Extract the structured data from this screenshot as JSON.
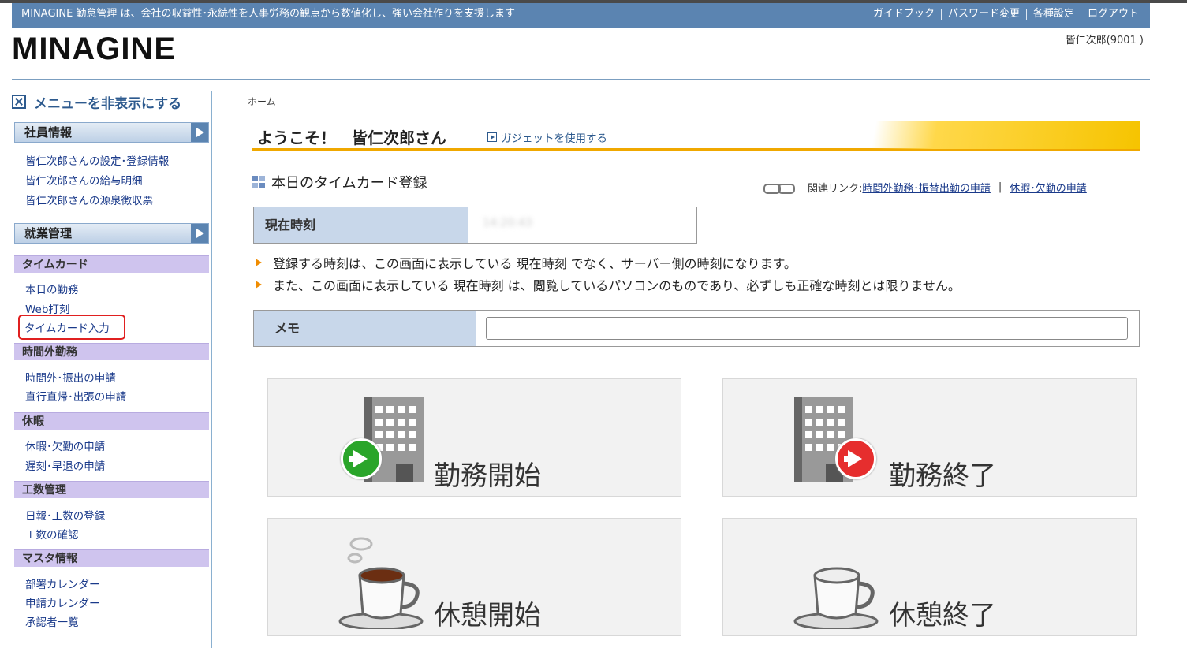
{
  "topbar": {
    "tagline": "MINAGINE 勤怠管理 は、会社の収益性･永続性を人事労務の観点から数値化し、強い会社作りを支援します",
    "links": [
      "ガイドブック",
      "パスワード変更",
      "各種設定",
      "ログアウト"
    ]
  },
  "header": {
    "logo": "MINAGINE",
    "user": "皆仁次郎(9001 )"
  },
  "sidebar": {
    "hide_menu": "メニューを非表示にする",
    "sections": {
      "employee": "社員情報",
      "employee_links": [
        "皆仁次郎さんの設定･登録情報",
        "皆仁次郎さんの給与明細",
        "皆仁次郎さんの源泉徴収票"
      ],
      "work": "就業管理",
      "timecard": "タイムカード",
      "timecard_links": [
        "本日の勤務",
        "Web打刻",
        "タイムカード入力"
      ],
      "overtime": "時間外勤務",
      "overtime_links": [
        "時間外･振出の申請",
        "直行直帰･出張の申請"
      ],
      "leave": "休暇",
      "leave_links": [
        "休暇･欠勤の申請",
        "遅刻･早退の申請"
      ],
      "manhours": "工数管理",
      "manhours_links": [
        "日報･工数の登録",
        "工数の確認"
      ],
      "master": "マスタ情報",
      "master_links": [
        "部署カレンダー",
        "申請カレンダー",
        "承認者一覧"
      ]
    }
  },
  "main": {
    "breadcrumb": "ホーム",
    "welcome": "ようこそ！　皆仁次郎さん",
    "gadget": "ガジェットを使用する",
    "section_title": "本日のタイムカード登録",
    "related_label": "関連リンク:",
    "related_links": [
      "時間外勤務･振替出勤の申請",
      "休暇･欠勤の申請"
    ],
    "related_sep": "|",
    "clock_label": "現在時刻",
    "clock_value": "14:20:43",
    "notes": [
      "登録する時刻は、この画面に表示している 現在時刻 でなく、サーバー側の時刻になります。",
      "また、この画面に表示している 現在時刻 は、閲覧しているパソコンのものであり、必ずしも正確な時刻とは限りません。"
    ],
    "memo_label": "メモ",
    "memo_value": "",
    "buttons": {
      "start_work": "勤務開始",
      "end_work": "勤務終了",
      "start_break": "休憩開始",
      "end_break": "休憩終了"
    }
  },
  "colors": {
    "topbar": "#5b84b1",
    "sidebar_sub": "#cfc4ee",
    "welcome_accent": "#f0a800",
    "start": "#2aa52a",
    "end": "#e62e2e"
  }
}
